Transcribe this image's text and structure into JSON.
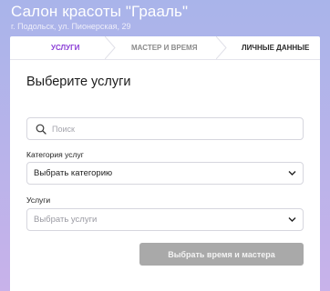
{
  "header": {
    "salon_name": "Салон красоты \"Грааль\"",
    "address": "г. Подольск, ул. Пионерская, 29"
  },
  "steps": [
    {
      "label": "УСЛУГИ",
      "state": "active",
      "color": "#8a3cd6"
    },
    {
      "label": "МАСТЕР И ВРЕМЯ",
      "state": "inactive",
      "color": "#8b8b8b"
    },
    {
      "label": "ЛИЧНЫЕ ДАННЫЕ",
      "state": "inactive",
      "color": "#2a2a2a"
    }
  ],
  "main": {
    "title": "Выберите услуги",
    "search": {
      "placeholder": "Поиск",
      "value": ""
    },
    "category": {
      "label": "Категория услуг",
      "value": "Выбрать категорию"
    },
    "services": {
      "label": "Услуги",
      "value": "Выбрать услуги"
    },
    "submit_label": "Выбрать время и мастера"
  },
  "icons": {
    "search": "search-icon",
    "dropdown": "chevron-down-icon"
  },
  "colors": {
    "accent": "#8a3cd6",
    "button_disabled": "#a9a9a9",
    "background_top": "#a9b4ea",
    "background_bottom": "#c8b2ea"
  }
}
